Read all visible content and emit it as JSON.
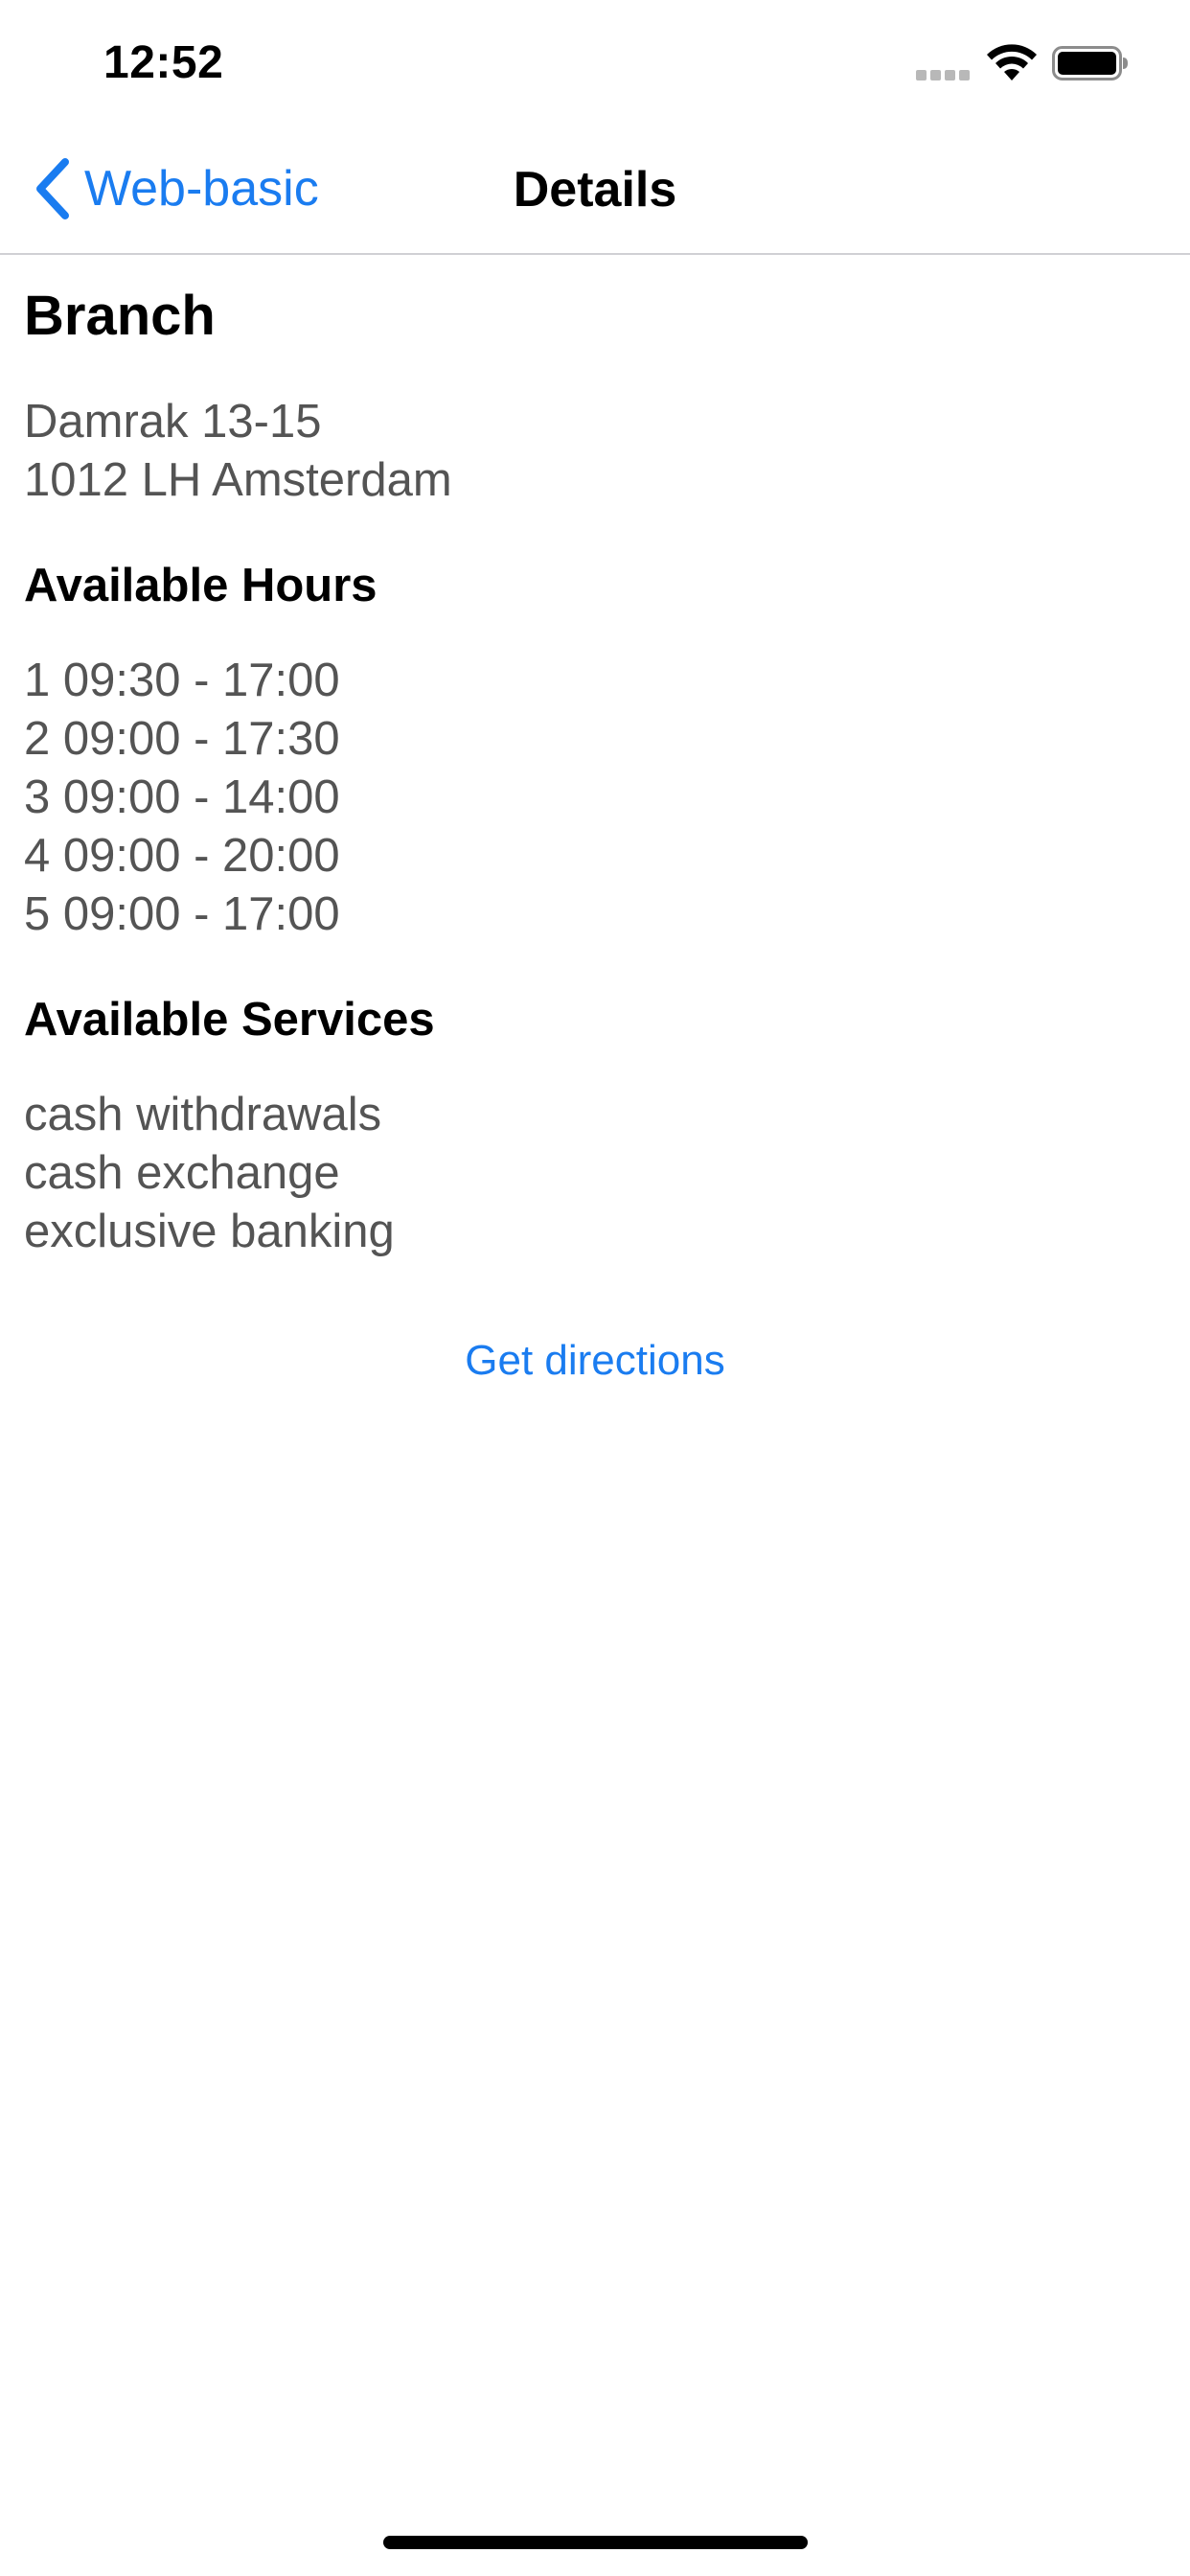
{
  "status_bar": {
    "time": "12:52",
    "icons": [
      "signal-icon",
      "wifi-icon",
      "battery-icon"
    ]
  },
  "nav": {
    "back_label": "Web-basic",
    "title": "Details",
    "back_icon": "chevron-left-icon"
  },
  "branch": {
    "title": "Branch",
    "address": [
      "Damrak 13-15",
      "1012 LH Amsterdam"
    ]
  },
  "hours": {
    "title": "Available Hours",
    "items": [
      "1 09:30 - 17:00",
      "2 09:00 - 17:30",
      "3 09:00 - 14:00",
      "4 09:00 - 20:00",
      "5 09:00 - 17:00"
    ]
  },
  "services": {
    "title": "Available Services",
    "items": [
      "cash withdrawals",
      "cash exchange",
      "exclusive banking"
    ]
  },
  "actions": {
    "directions_label": "Get directions"
  },
  "colors": {
    "accent": "#1a7cf0",
    "secondary_text": "#545454",
    "separator": "#d0d0d4"
  }
}
